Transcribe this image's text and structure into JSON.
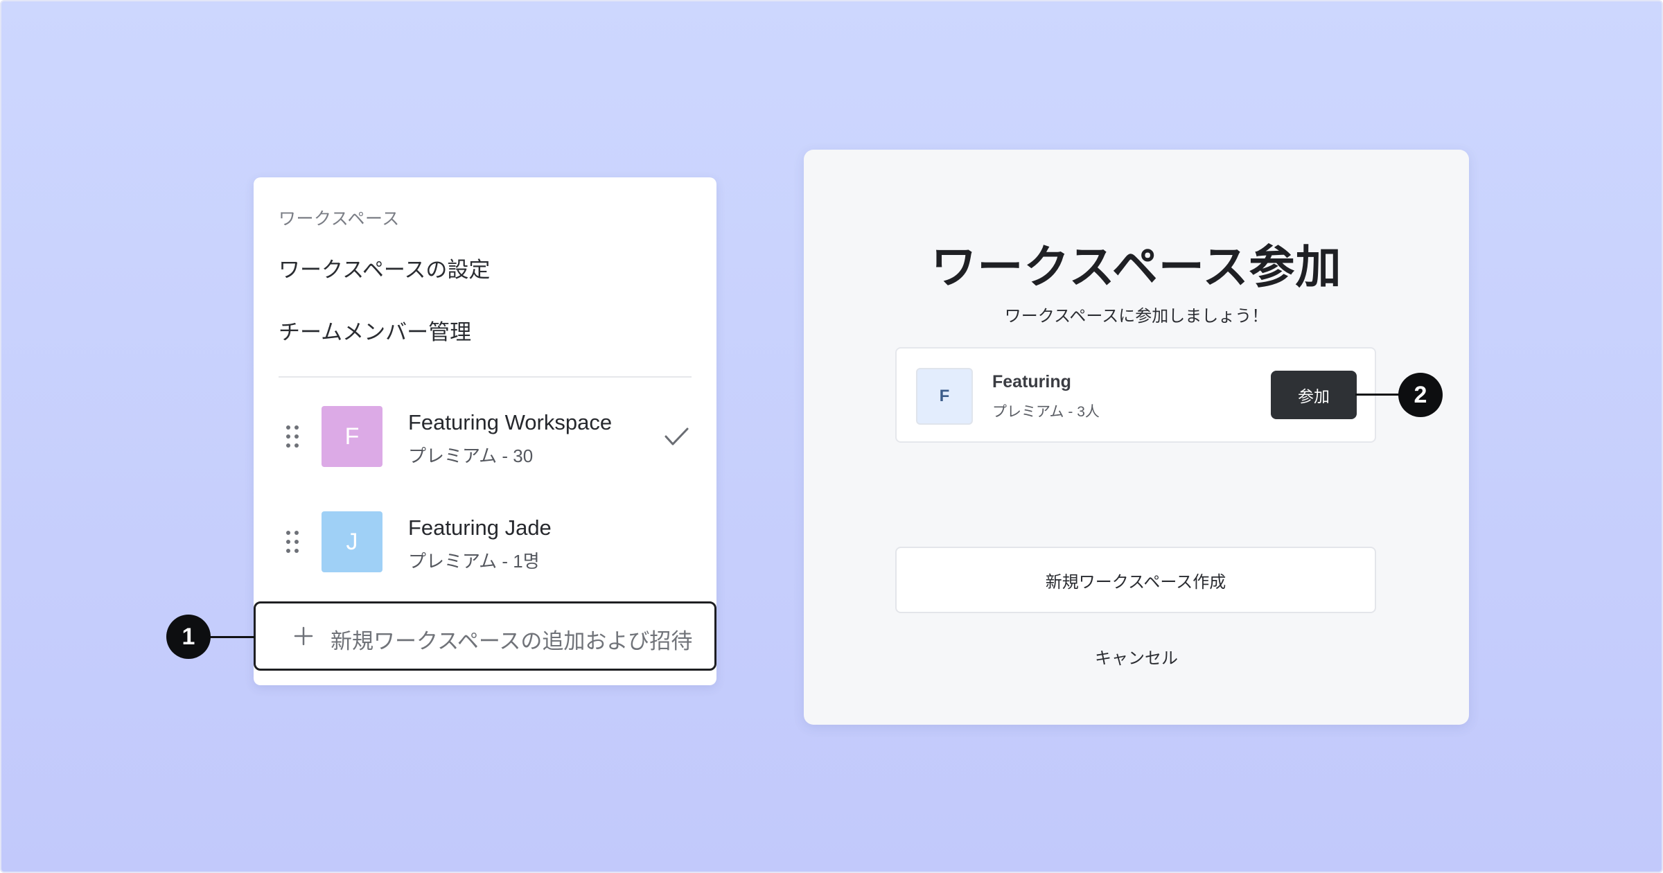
{
  "colors": {
    "background_top": "#cdd7fe",
    "background_bottom": "#c2c9fb",
    "avatar_featuring_workspace": "#dcaae6",
    "avatar_featuring_jade": "#9fd0f6",
    "join_button": "#2e3135",
    "callout": "#0d0e10"
  },
  "menu": {
    "section_title": "ワークスペース",
    "items": [
      {
        "label": "ワークスペースの設定"
      },
      {
        "label": "チームメンバー管理"
      }
    ],
    "workspaces": [
      {
        "avatar_letter": "F",
        "name": "Featuring Workspace",
        "plan": "プレミアム - 30",
        "selected": true,
        "icon": "check-icon"
      },
      {
        "avatar_letter": "J",
        "name": "Featuring Jade",
        "plan": "プレミアム - 1명",
        "selected": false
      }
    ],
    "add_label": "新規ワークスペースの追加および招待",
    "add_icon": "plus-icon"
  },
  "callouts": [
    {
      "number": "1"
    },
    {
      "number": "2"
    }
  ],
  "join_dialog": {
    "title": "ワークスペース参加",
    "subtitle": "ワークスペースに参加しましょう！",
    "invite": {
      "avatar_letter": "F",
      "name": "Featuring",
      "plan": "プレミアム - 3人",
      "join_label": "参加"
    },
    "create_label": "新規ワークスペース作成",
    "cancel_label": "キャンセル"
  }
}
